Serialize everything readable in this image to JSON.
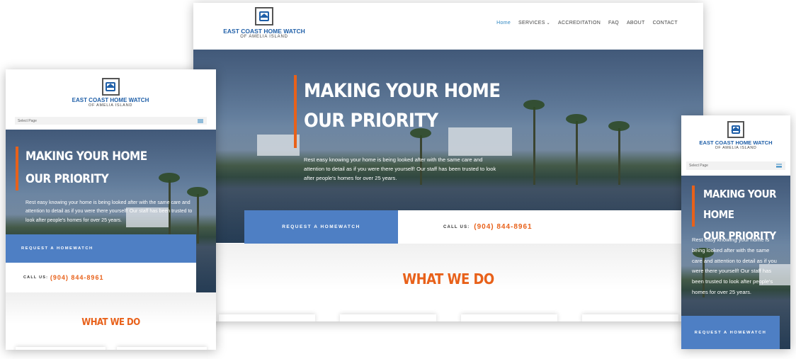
{
  "brand": {
    "name": "EAST COAST HOME WATCH",
    "sub": "OF AMELIA ISLAND"
  },
  "nav": {
    "items": [
      "Home",
      "SERVICES",
      "ACCREDITATION",
      "FAQ",
      "ABOUT",
      "CONTACT"
    ],
    "active": "Home"
  },
  "mobile": {
    "select_label": "Select Page"
  },
  "hero": {
    "line1": "MAKING YOUR HOME",
    "line2": "OUR PRIORITY",
    "text": "Rest easy knowing your home is being looked after with the same care and attention to detail as if you were there yourself! Our staff has been trusted to look after people's homes for over 25 years."
  },
  "cta": {
    "request": "REQUEST A HOMEWATCH",
    "call_label": "CALL US:",
    "phone": "(904) 844-8961"
  },
  "section": {
    "what_we_do": "WHAT WE DO"
  },
  "colors": {
    "accent_orange": "#e8611a",
    "brand_blue": "#1f5fa8",
    "button_blue": "#4e7fc4"
  }
}
